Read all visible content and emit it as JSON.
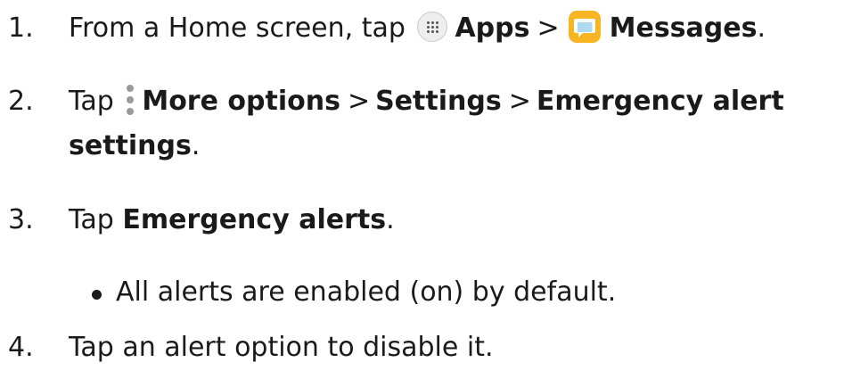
{
  "steps": [
    {
      "number": "1.",
      "prefix": "From a Home screen, tap",
      "apps_icon": "apps-grid-icon",
      "apps_label": "Apps",
      "separator": ">",
      "messages_icon": "messages-icon",
      "messages_label": "Messages",
      "end": "."
    },
    {
      "number": "2.",
      "prefix": "Tap",
      "more_icon": "more-options-icon",
      "more_label": "More options",
      "separator1": ">",
      "settings_label": "Settings",
      "separator2": ">",
      "emergency_label_part1": "Emergency alert",
      "emergency_label_part2": "settings",
      "end": "."
    },
    {
      "number": "3.",
      "prefix": "Tap",
      "alerts_label": "Emergency alerts",
      "end": ".",
      "bullet": "All alerts are enabled (on) by default."
    },
    {
      "number": "4.",
      "text": "Tap an alert option to disable it."
    }
  ],
  "colors": {
    "text": "#1a1a1a",
    "messages_icon_bg": "#f7b523",
    "kebab_dots": "#9a9a9a"
  }
}
